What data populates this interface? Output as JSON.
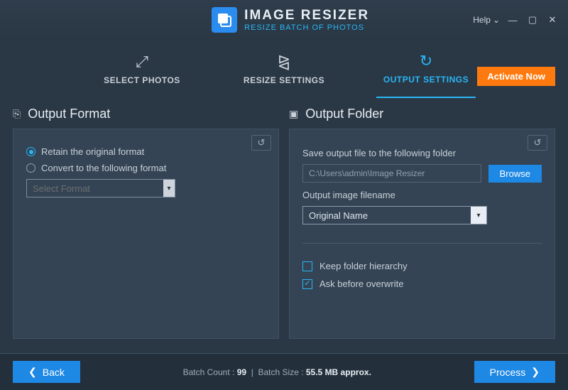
{
  "app": {
    "title": "IMAGE RESIZER",
    "subtitle": "RESIZE BATCH OF PHOTOS"
  },
  "titlebar": {
    "help": "Help"
  },
  "tabs": {
    "select": "SELECT PHOTOS",
    "resize": "RESIZE SETTINGS",
    "output": "OUTPUT SETTINGS",
    "activate": "Activate Now"
  },
  "format": {
    "title": "Output Format",
    "retain": "Retain the original format",
    "convert": "Convert to the following format",
    "select_placeholder": "Select Format"
  },
  "folder": {
    "title": "Output Folder",
    "save_label": "Save output file to the following folder",
    "path": "C:\\Users\\admin\\Image Resizer",
    "browse": "Browse",
    "filename_label": "Output image filename",
    "filename_value": "Original Name",
    "keep_hierarchy": "Keep folder hierarchy",
    "ask_overwrite": "Ask before overwrite"
  },
  "footer": {
    "back": "Back",
    "process": "Process",
    "count_label": "Batch Count :",
    "count_value": "99",
    "size_label": "Batch Size :",
    "size_value": "55.5 MB approx."
  }
}
